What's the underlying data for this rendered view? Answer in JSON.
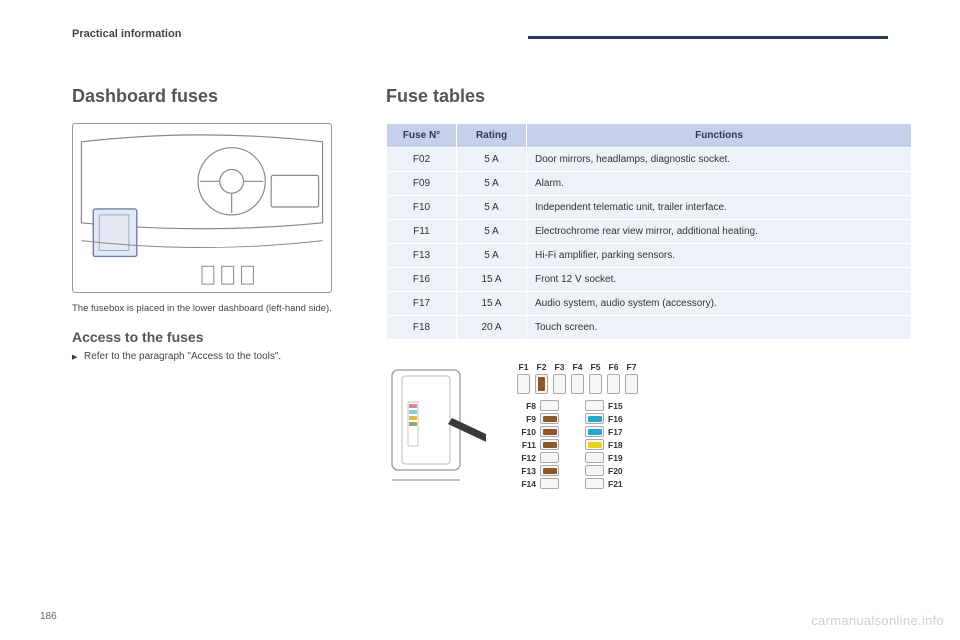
{
  "section": "Practical information",
  "page_number": "186",
  "watermark": "carmanualsonline.info",
  "left": {
    "title": "Dashboard fuses",
    "caption": "The fusebox is placed in the lower dashboard (left-hand side).",
    "subtitle": "Access to the fuses",
    "bullet": "Refer to the paragraph \"Access to the tools\"."
  },
  "right": {
    "title": "Fuse tables",
    "headers": {
      "c1": "Fuse N°",
      "c2": "Rating",
      "c3": "Functions"
    },
    "rows": [
      {
        "n": "F02",
        "r": "5 A",
        "f": "Door mirrors, headlamps, diagnostic socket."
      },
      {
        "n": "F09",
        "r": "5 A",
        "f": "Alarm."
      },
      {
        "n": "F10",
        "r": "5 A",
        "f": "Independent telematic unit, trailer interface."
      },
      {
        "n": "F11",
        "r": "5 A",
        "f": "Electrochrome rear view mirror, additional heating."
      },
      {
        "n": "F13",
        "r": "5 A",
        "f": "Hi-Fi amplifier, parking sensors."
      },
      {
        "n": "F16",
        "r": "15 A",
        "f": "Front 12 V socket."
      },
      {
        "n": "F17",
        "r": "15 A",
        "f": "Audio system, audio system (accessory)."
      },
      {
        "n": "F18",
        "r": "20 A",
        "f": "Touch screen."
      }
    ]
  },
  "fusemap": {
    "top": [
      {
        "label": "F1",
        "color": ""
      },
      {
        "label": "F2",
        "color": "#8a5a2a"
      },
      {
        "label": "F3",
        "color": ""
      },
      {
        "label": "F4",
        "color": ""
      },
      {
        "label": "F5",
        "color": ""
      },
      {
        "label": "F6",
        "color": ""
      },
      {
        "label": "F7",
        "color": ""
      }
    ],
    "left": [
      {
        "label": "F8",
        "color": ""
      },
      {
        "label": "F9",
        "color": "#8a5a2a"
      },
      {
        "label": "F10",
        "color": "#8a5a2a"
      },
      {
        "label": "F11",
        "color": "#8a5a2a"
      },
      {
        "label": "F12",
        "color": ""
      },
      {
        "label": "F13",
        "color": "#8a5a2a"
      },
      {
        "label": "F14",
        "color": ""
      }
    ],
    "rightcol": [
      {
        "label": "F15",
        "color": ""
      },
      {
        "label": "F16",
        "color": "#2aa6c9"
      },
      {
        "label": "F17",
        "color": "#2aa6c9"
      },
      {
        "label": "F18",
        "color": "#e8d21a"
      },
      {
        "label": "F19",
        "color": ""
      },
      {
        "label": "F20",
        "color": ""
      },
      {
        "label": "F21",
        "color": ""
      }
    ]
  }
}
